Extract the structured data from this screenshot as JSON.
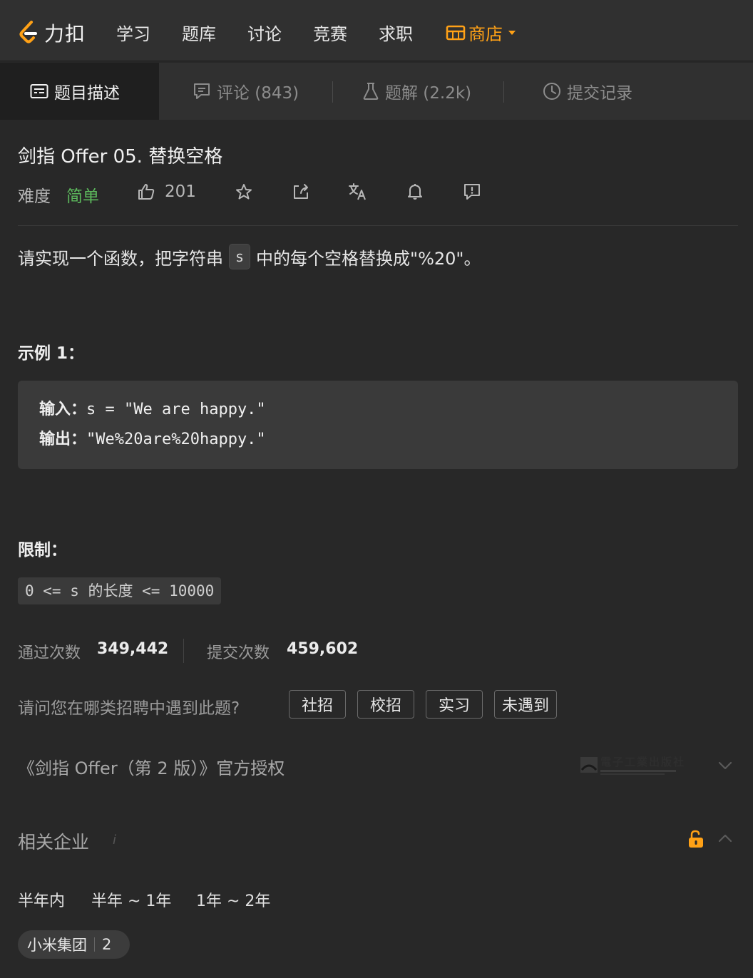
{
  "nav": {
    "logo_text": "力扣",
    "items": [
      "学习",
      "题库",
      "讨论",
      "竞赛",
      "求职"
    ],
    "store_label": "商店",
    "accent_color": "#ffa116"
  },
  "tabs": [
    {
      "label": "题目描述",
      "icon": "description-icon",
      "active": true
    },
    {
      "label": "评论 (843)",
      "icon": "comment-icon",
      "active": false
    },
    {
      "label": "题解 (2.2k)",
      "icon": "flask-icon",
      "active": false
    },
    {
      "label": "提交记录",
      "icon": "clock-icon",
      "active": false
    }
  ],
  "problem": {
    "title": "剑指 Offer 05. 替换空格",
    "difficulty_label": "难度",
    "difficulty": "简单",
    "difficulty_color": "#5cb85c",
    "likes": "201",
    "desc_before": "请实现一个函数，把字符串",
    "desc_code": "s",
    "desc_after": "中的每个空格替换成\"%20\"。",
    "example_heading": "示例 1：",
    "example_input_key": "输入：",
    "example_input_val": "s = \"We are happy.\"",
    "example_output_key": "输出：",
    "example_output_val": "\"We%20are%20happy.\"",
    "limits_heading": "限制：",
    "constraint": "0 <= s 的长度 <= 10000"
  },
  "stats": {
    "accepted_label": "通过次数",
    "accepted_value": "349,442",
    "submitted_label": "提交次数",
    "submitted_value": "459,602"
  },
  "survey": {
    "question": "请问您在哪类招聘中遇到此题?",
    "options": [
      "社招",
      "校招",
      "实习",
      "未遇到"
    ]
  },
  "authorization": {
    "text": "《剑指 Offer（第 2 版）》官方授权",
    "publisher": "電子工業出版社"
  },
  "related": {
    "heading": "相关企业",
    "info_mark": "i",
    "periods": [
      "半年内",
      "半年 ~ 1年",
      "1年 ~ 2年"
    ],
    "company_name": "小米集团",
    "company_count": "2"
  }
}
